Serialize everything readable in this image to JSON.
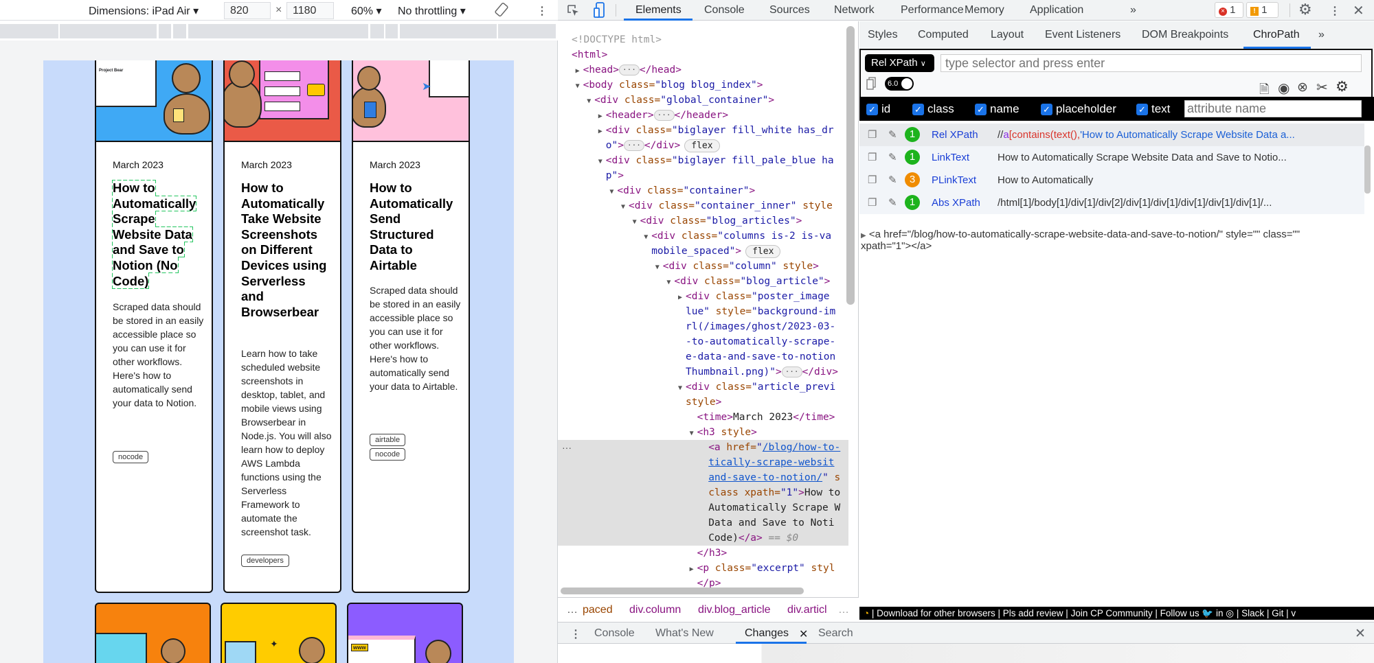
{
  "device_toolbar": {
    "dimensions_label": "Dimensions: iPad Air ▾",
    "width": "820",
    "times": "×",
    "height": "1180",
    "zoom": "60% ▾",
    "throttling": "No throttling ▾",
    "rotate_icon": "rotate-icon",
    "more_icon": "⋮"
  },
  "page": {
    "bg_color": "#c8dbfb",
    "articles": [
      {
        "date": "March 2023",
        "title": "How to Automatically Scrape Website Data and Save to Notion (No Code)",
        "excerpt": "Scraped data should be stored in an easily accessible place so you can use it for other workflows. Here's how to automatically send your data to Notion.",
        "tags": [
          "nocode"
        ],
        "poster_color": "#3fa9f5",
        "highlighted": true
      },
      {
        "date": "March 2023",
        "title": "How to Automatically Take Website Screenshots on Different Devices using Serverless and Browserbear",
        "excerpt": "Learn how to take scheduled website screenshots in desktop, tablet, and mobile views using Browserbear in Node.js. You will also learn how to deploy AWS Lambda functions using the Serverless Framework to automate the screenshot task.",
        "tags": [
          "developers"
        ],
        "poster_color": "#ea5a47"
      },
      {
        "date": "March 2023",
        "title": "How to Automatically Send Structured Data to Airtable",
        "excerpt": "Scraped data should be stored in an easily accessible place so you can use it for other workflows. Here's how to automatically send your data to Airtable.",
        "tags": [
          "airtable",
          "nocode"
        ],
        "poster_color": "#ffc1dc"
      }
    ],
    "next_row_poster_colors": [
      "#f7820d",
      "#ffcc00",
      "#8c5cff"
    ],
    "poster_label": "Project Bear",
    "poster_www": "www"
  },
  "devtools": {
    "tabs": [
      "Elements",
      "Console",
      "Sources",
      "Network",
      "Performance",
      "Memory",
      "Application",
      "»"
    ],
    "active_tab": "Elements",
    "errors": "1",
    "warnings": "1",
    "elements_tree": [
      {
        "d": 0,
        "t": [
          [
            "dc",
            "<!DOCTYPE html>"
          ]
        ]
      },
      {
        "d": 0,
        "t": [
          [
            "tg",
            "<html>"
          ]
        ]
      },
      {
        "d": 1,
        "a": "c",
        "t": [
          [
            "tg",
            "<head>"
          ],
          [
            "pill",
            "···"
          ],
          [
            "tg",
            "</head>"
          ]
        ]
      },
      {
        "d": 1,
        "a": "o",
        "t": [
          [
            "tg",
            "<body "
          ],
          [
            "at",
            "class="
          ],
          [
            "vl",
            "\"blog blog_index\""
          ],
          [
            "tg",
            ">"
          ]
        ]
      },
      {
        "d": 2,
        "a": "o",
        "t": [
          [
            "tg",
            "<div "
          ],
          [
            "at",
            "class="
          ],
          [
            "vl",
            "\"global_container\""
          ],
          [
            "tg",
            ">"
          ]
        ]
      },
      {
        "d": 3,
        "a": "c",
        "t": [
          [
            "tg",
            "<header>"
          ],
          [
            "pill",
            "···"
          ],
          [
            "tg",
            "</header>"
          ]
        ]
      },
      {
        "d": 3,
        "a": "c",
        "t": [
          [
            "tg",
            "<div "
          ],
          [
            "at",
            "class="
          ],
          [
            "vl",
            "\"biglayer fill_white has_dr"
          ]
        ]
      },
      {
        "d": 3,
        "t": [
          [
            "vl",
            "o\""
          ],
          [
            "tg",
            ">"
          ],
          [
            "pill",
            "···"
          ],
          [
            "tg",
            "</div>"
          ],
          [
            "flex",
            "flex"
          ]
        ]
      },
      {
        "d": 3,
        "a": "o",
        "t": [
          [
            "tg",
            "<div "
          ],
          [
            "at",
            "class="
          ],
          [
            "vl",
            "\"biglayer fill_pale_blue ha"
          ]
        ]
      },
      {
        "d": 3,
        "t": [
          [
            "vl",
            "p\""
          ],
          [
            "tg",
            ">"
          ]
        ]
      },
      {
        "d": 4,
        "a": "o",
        "t": [
          [
            "tg",
            "<div "
          ],
          [
            "at",
            "class="
          ],
          [
            "vl",
            "\"container\""
          ],
          [
            "tg",
            ">"
          ]
        ]
      },
      {
        "d": 5,
        "a": "o",
        "t": [
          [
            "tg",
            "<div "
          ],
          [
            "at",
            "class="
          ],
          [
            "vl",
            "\"container_inner\" "
          ],
          [
            "at",
            "style"
          ]
        ]
      },
      {
        "d": 6,
        "a": "o",
        "t": [
          [
            "tg",
            "<div "
          ],
          [
            "at",
            "class="
          ],
          [
            "vl",
            "\"blog_articles\""
          ],
          [
            "tg",
            ">"
          ]
        ]
      },
      {
        "d": 7,
        "a": "o",
        "t": [
          [
            "tg",
            "<div "
          ],
          [
            "at",
            "class="
          ],
          [
            "vl",
            "\"columns is-2 is-va"
          ]
        ]
      },
      {
        "d": 7,
        "t": [
          [
            "vl",
            "mobile_spaced\""
          ],
          [
            "tg",
            ">"
          ],
          [
            "flex",
            "flex"
          ]
        ]
      },
      {
        "d": 8,
        "a": "o",
        "t": [
          [
            "tg",
            "<div "
          ],
          [
            "at",
            "class="
          ],
          [
            "vl",
            "\"column\" "
          ],
          [
            "at",
            "style"
          ],
          [
            "tg",
            ">"
          ]
        ]
      },
      {
        "d": 9,
        "a": "o",
        "t": [
          [
            "tg",
            "<div "
          ],
          [
            "at",
            "class="
          ],
          [
            "vl",
            "\"blog_article\""
          ],
          [
            "tg",
            ">"
          ]
        ]
      },
      {
        "d": 10,
        "a": "c",
        "t": [
          [
            "tg",
            "<div "
          ],
          [
            "at",
            "class="
          ],
          [
            "vl",
            "\"poster_image"
          ]
        ]
      },
      {
        "d": 10,
        "t": [
          [
            "vl",
            "lue\" "
          ],
          [
            "at",
            "style="
          ],
          [
            "vl",
            "\"background-im"
          ]
        ]
      },
      {
        "d": 10,
        "t": [
          [
            "vl",
            "rl(/images/ghost/2023-03-"
          ]
        ]
      },
      {
        "d": 10,
        "t": [
          [
            "vl",
            "-to-automatically-scrape-"
          ]
        ]
      },
      {
        "d": 10,
        "t": [
          [
            "vl",
            "e-data-and-save-to-notion"
          ]
        ]
      },
      {
        "d": 10,
        "t": [
          [
            "vl",
            "Thumbnail.png)\""
          ],
          [
            "tg",
            ">"
          ],
          [
            "pill",
            "···"
          ],
          [
            "tg",
            "</div>"
          ]
        ]
      },
      {
        "d": 10,
        "a": "o",
        "t": [
          [
            "tg",
            "<div "
          ],
          [
            "at",
            "class="
          ],
          [
            "vl",
            "\"article_previ"
          ]
        ]
      },
      {
        "d": 10,
        "t": [
          [
            "at",
            "style"
          ],
          [
            "tg",
            ">"
          ]
        ]
      },
      {
        "d": 11,
        "t": [
          [
            "tg",
            "<time>"
          ],
          [
            "tx",
            "March 2023"
          ],
          [
            "tg",
            "</time>"
          ]
        ]
      },
      {
        "d": 11,
        "a": "o",
        "t": [
          [
            "tg",
            "<h3 "
          ],
          [
            "at",
            "style"
          ],
          [
            "tg",
            ">"
          ]
        ]
      },
      {
        "d": 12,
        "s": 1,
        "t": [
          [
            "tg",
            "<a "
          ],
          [
            "at",
            "href="
          ],
          [
            "vl",
            "\""
          ],
          [
            "lk",
            "/blog/how-to-"
          ]
        ]
      },
      {
        "d": 12,
        "s": 1,
        "t": [
          [
            "lk",
            "tically-scrape-websit"
          ]
        ]
      },
      {
        "d": 12,
        "s": 1,
        "t": [
          [
            "lk",
            "and-save-to-notion/"
          ],
          [
            "vl",
            "\" "
          ],
          [
            "at",
            "s"
          ]
        ]
      },
      {
        "d": 12,
        "s": 1,
        "t": [
          [
            "at",
            "class xpath="
          ],
          [
            "vl",
            "\"1\""
          ],
          [
            "tg",
            ">"
          ],
          [
            "tx",
            "How to"
          ]
        ]
      },
      {
        "d": 12,
        "s": 1,
        "t": [
          [
            "tx",
            "Automatically Scrape W"
          ]
        ]
      },
      {
        "d": 12,
        "s": 1,
        "t": [
          [
            "tx",
            "Data and Save to Noti"
          ]
        ]
      },
      {
        "d": 12,
        "s": 1,
        "t": [
          [
            "tx",
            "Code)"
          ],
          [
            "tg",
            "</a>"
          ],
          [
            "eq",
            " == "
          ],
          [
            "dl",
            "$0"
          ]
        ]
      },
      {
        "d": 11,
        "t": [
          [
            "tg",
            "</h3>"
          ]
        ]
      },
      {
        "d": 11,
        "a": "c",
        "t": [
          [
            "tg",
            "<p "
          ],
          [
            "at",
            "class="
          ],
          [
            "vl",
            "\"excerpt\" "
          ],
          [
            "at",
            "styl"
          ]
        ]
      },
      {
        "d": 11,
        "t": [
          [
            "tg",
            "</p>"
          ]
        ]
      }
    ],
    "selected_row_ellipsis": "···",
    "breadcrumbs": [
      "…",
      "paced",
      "div.column",
      "div.blog_article",
      "div.articl",
      "…"
    ],
    "sidebar_tabs": [
      "Styles",
      "Computed",
      "Layout",
      "Event Listeners",
      "DOM Breakpoints",
      "ChroPath",
      "»"
    ],
    "active_sidebar_tab": "ChroPath",
    "chropath": {
      "selector_type": "Rel XPath",
      "selector_placeholder": "type selector and press enter",
      "version": "6.0",
      "checkboxes": [
        {
          "label": "id",
          "checked": true
        },
        {
          "label": "class",
          "checked": true
        },
        {
          "label": "name",
          "checked": true
        },
        {
          "label": "placeholder",
          "checked": true
        },
        {
          "label": "text",
          "checked": true
        }
      ],
      "attribute_placeholder": "attribute name",
      "results": [
        {
          "count": "1",
          "type": "Rel XPath",
          "value_parts": [
            "//",
            "a",
            "[contains(text(),",
            "'How to Automatically Scrape Website Data a..."
          ],
          "badge_color": "#1db31d"
        },
        {
          "count": "1",
          "type": "LinkText",
          "value": "How to Automatically Scrape Website Data and Save to Notio...",
          "badge_color": "#1db31d"
        },
        {
          "count": "3",
          "type": "PLinkText",
          "value": "How to Automatically",
          "badge_color": "#f08c00"
        },
        {
          "count": "1",
          "type": "Abs XPath",
          "value": "/html[1]/body[1]/div[1]/div[2]/div[1]/div[1]/div[1]/div[1]/div[1]/...",
          "badge_color": "#1db31d"
        }
      ],
      "html_line1": "<a href=\"/blog/how-to-automatically-scrape-website-data-and-save-to-notion/\" style=\"\" class=\"\"",
      "html_line2": "xpath=\"1\"></a>",
      "footer": "| Download for other browsers | Pls add review | Join CP Community | Follow us",
      "footer_tail": "| Slack | Git | v"
    },
    "drawer_tabs": [
      "Console",
      "What's New",
      "Changes",
      "Search"
    ],
    "active_drawer_tab": "Changes"
  }
}
